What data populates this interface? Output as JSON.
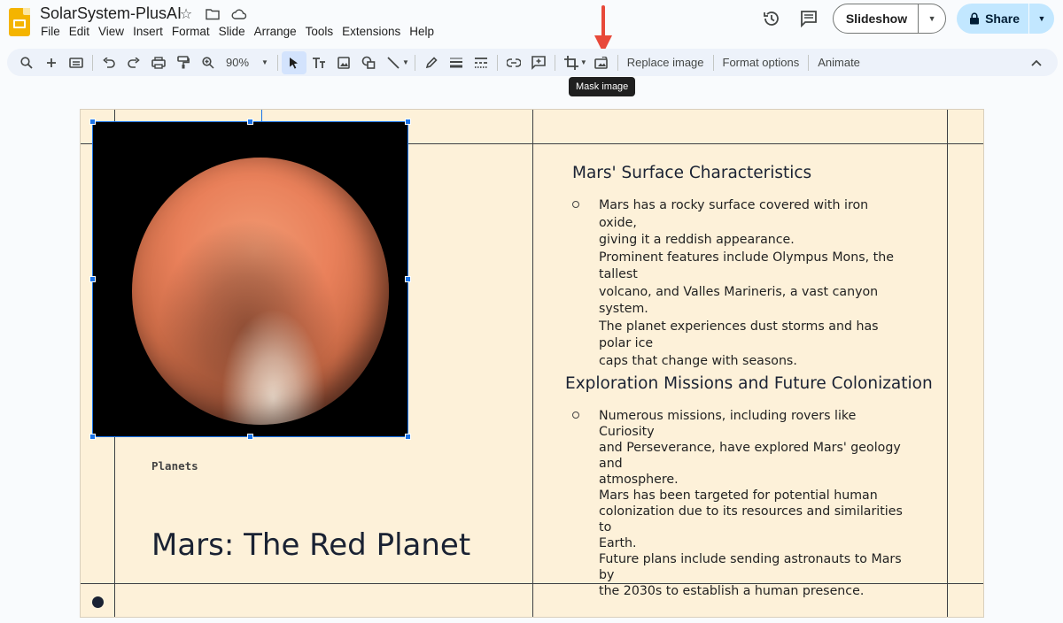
{
  "app": {
    "title": "SolarSystem-PlusAI",
    "menu": [
      "File",
      "Edit",
      "View",
      "Insert",
      "Format",
      "Slide",
      "Arrange",
      "Tools",
      "Extensions",
      "Help"
    ],
    "slideshow_label": "Slideshow",
    "share_label": "Share"
  },
  "toolbar": {
    "zoom": "90%",
    "replace_image": "Replace image",
    "format_options": "Format options",
    "animate": "Animate",
    "tooltip": "Mask image"
  },
  "slide": {
    "kicker": "Planets",
    "title": "Mars: The Red Planet",
    "section1": {
      "heading": "Mars' Surface Characteristics",
      "lines": [
        "Mars has a rocky surface covered with iron oxide,",
        "giving it a reddish appearance.",
        "Prominent features include Olympus Mons, the tallest",
        "volcano, and Valles Marineris, a vast canyon system.",
        "The planet experiences dust storms and has polar ice",
        "caps that change with seasons."
      ]
    },
    "section2": {
      "heading": "Exploration Missions and Future Colonization",
      "lines": [
        "Numerous missions, including rovers like Curiosity",
        "and Perseverance, have explored Mars' geology and",
        "atmosphere.",
        "Mars has been targeted for potential human",
        "colonization due to its resources and similarities to",
        "Earth.",
        "Future plans include sending astronauts to Mars by",
        "the 2030s to establish a human presence."
      ]
    }
  }
}
